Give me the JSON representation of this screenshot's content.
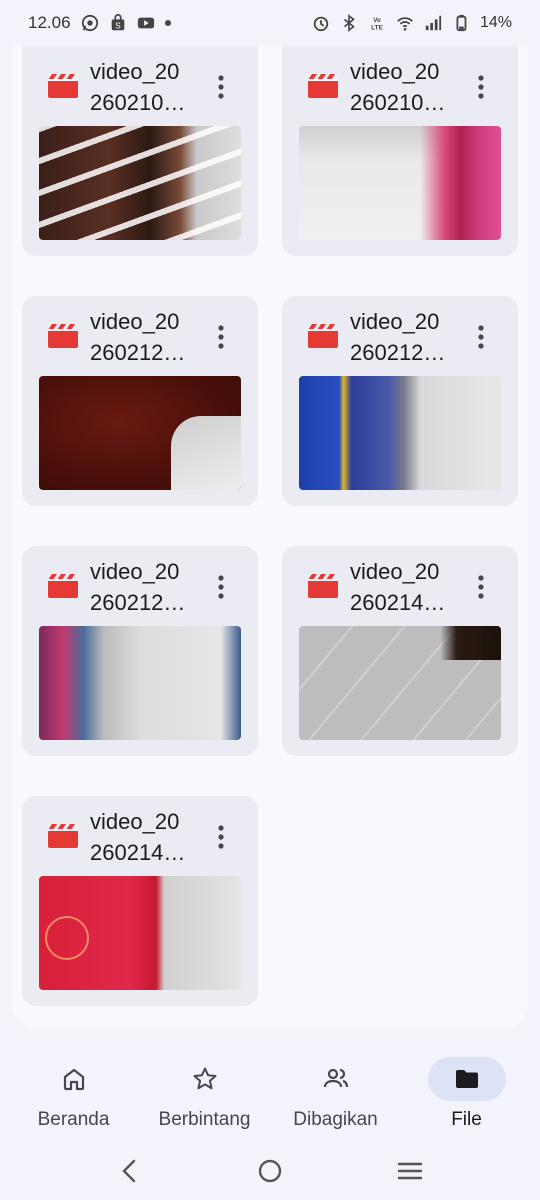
{
  "status_bar": {
    "time": "12.06",
    "battery": "14%",
    "network": "VoLTE"
  },
  "files": [
    {
      "name": "video_20\n260210…",
      "line1": "video_20",
      "line2": "260210…",
      "thumb": "store-shelf"
    },
    {
      "name": "video_20\n260210…",
      "line1": "video_20",
      "line2": "260210…",
      "thumb": "store-floor"
    },
    {
      "name": "video_20\n260212…",
      "line1": "video_20",
      "line2": "260212…",
      "thumb": "dark-red"
    },
    {
      "name": "video_20\n260212…",
      "line1": "video_20",
      "line2": "260212…",
      "thumb": "blue-basket"
    },
    {
      "name": "video_20\n260212…",
      "line1": "video_20",
      "line2": "260212…",
      "thumb": "aisle-blur"
    },
    {
      "name": "video_20\n260214…",
      "line1": "video_20",
      "line2": "260214…",
      "thumb": "tiled-floor"
    },
    {
      "name": "video_20\n260214…",
      "line1": "video_20",
      "line2": "260214…",
      "thumb": "red-basket"
    }
  ],
  "bottom_nav": {
    "items": [
      {
        "label": "Beranda",
        "icon": "home-icon"
      },
      {
        "label": "Berbintang",
        "icon": "star-icon"
      },
      {
        "label": "Dibagikan",
        "icon": "people-icon"
      },
      {
        "label": "File",
        "icon": "folder-icon",
        "active": true
      }
    ]
  },
  "colors": {
    "accent_red": "#e53935",
    "active_pill": "#dde3f7",
    "card_bg": "#ebebf3"
  }
}
